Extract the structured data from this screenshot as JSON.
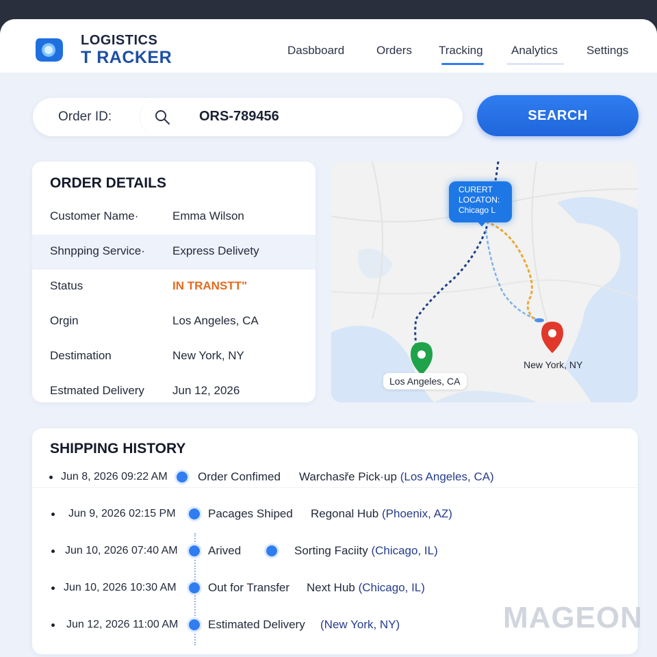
{
  "app": {
    "logo_line1": "LOGISTICS",
    "logo_line2": "T RACKER"
  },
  "nav": {
    "items": [
      {
        "label": "Dasbboard",
        "active": false
      },
      {
        "label": "Orders",
        "active": false
      },
      {
        "label": "Tracking",
        "active": true
      },
      {
        "label": "Analytics",
        "active": false
      },
      {
        "label": "Settings",
        "active": false
      }
    ]
  },
  "search": {
    "label": "Order ID:",
    "value": "ORS-789456",
    "button_label": "SEARCH"
  },
  "order_details": {
    "title": "ORDER DETAILS",
    "rows": [
      {
        "label": "Customer Name·",
        "value": "Emma Wilson"
      },
      {
        "label": "Shnpping Service·",
        "value": "Express Delivety"
      },
      {
        "label": "Status",
        "value": "IN TRANSTT\""
      },
      {
        "label": "Orgin",
        "value": "Los Angeles, CA"
      },
      {
        "label": "Destimation",
        "value": "New York, NY"
      },
      {
        "label": "Estmated Delivery",
        "value": "Jun 12, 2026"
      }
    ]
  },
  "map": {
    "current_location_line1": "CURERT",
    "current_location_line2": "LOCATON:",
    "current_location_line3": "Chicago L",
    "origin_label": "Los Angeles, CA",
    "destination_label": "New York, NY"
  },
  "history": {
    "title": "SHIPPING HISTORY",
    "rows": [
      {
        "date": "Jun 8, 2026 09:22 AM",
        "event": "Order Confimed",
        "place": "Warchasře Pick·up",
        "city": "(Los Angeles, CA)"
      },
      {
        "date": "Jun 9, 2026 02:15 PM",
        "event": "Pacages Shiped",
        "place": "Regonal Hub",
        "city": "(Phoenix, AZ)"
      },
      {
        "date": "Jun 10, 2026 07:40 AM",
        "event": "Arived",
        "place": "Sorting Faciity",
        "city": "(Chicago, IL)"
      },
      {
        "date": "Jun 10, 2026 10:30 AM",
        "event": "Out for Transfer",
        "place": "Next Hub",
        "city": "(Chicago, IL)"
      },
      {
        "date": "Jun 12, 2026 11:00 AM",
        "event": "Estimated Delivery",
        "place": "",
        "city": "(New York, NY)"
      }
    ]
  },
  "watermark": "MAGEON",
  "colors": {
    "accent": "#1f66db",
    "status": "#e46a1c",
    "origin_pin": "#1fa34a",
    "destination_pin": "#e0392b"
  }
}
